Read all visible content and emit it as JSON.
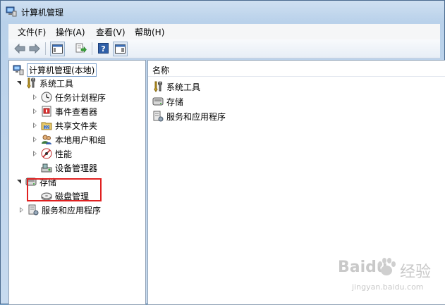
{
  "window": {
    "title": "计算机管理"
  },
  "menu": [
    "文件(F)",
    "操作(A)",
    "查看(V)",
    "帮助(H)"
  ],
  "toolbar": {
    "buttons": [
      "back-icon",
      "forward-icon",
      "show-hide-tree-icon",
      "export-list-icon",
      "help-icon",
      "show-hide-action-pane-icon"
    ]
  },
  "tree": {
    "root": "计算机管理(本地)",
    "system_tools": "系统工具",
    "task_scheduler": "任务计划程序",
    "event_viewer": "事件查看器",
    "shared_folders": "共享文件夹",
    "local_users": "本地用户和组",
    "performance": "性能",
    "device_manager": "设备管理器",
    "storage": "存储",
    "disk_management": "磁盘管理",
    "services_apps": "服务和应用程序"
  },
  "list": {
    "header": "名称",
    "items": [
      "系统工具",
      "存储",
      "服务和应用程序"
    ]
  },
  "watermark": {
    "brand": "Baidu",
    "brand_cn": "经验",
    "url": "jingyan.baidu.com"
  },
  "colors": {
    "highlight": "#e02020",
    "titlebar": "#b9d1ea"
  }
}
